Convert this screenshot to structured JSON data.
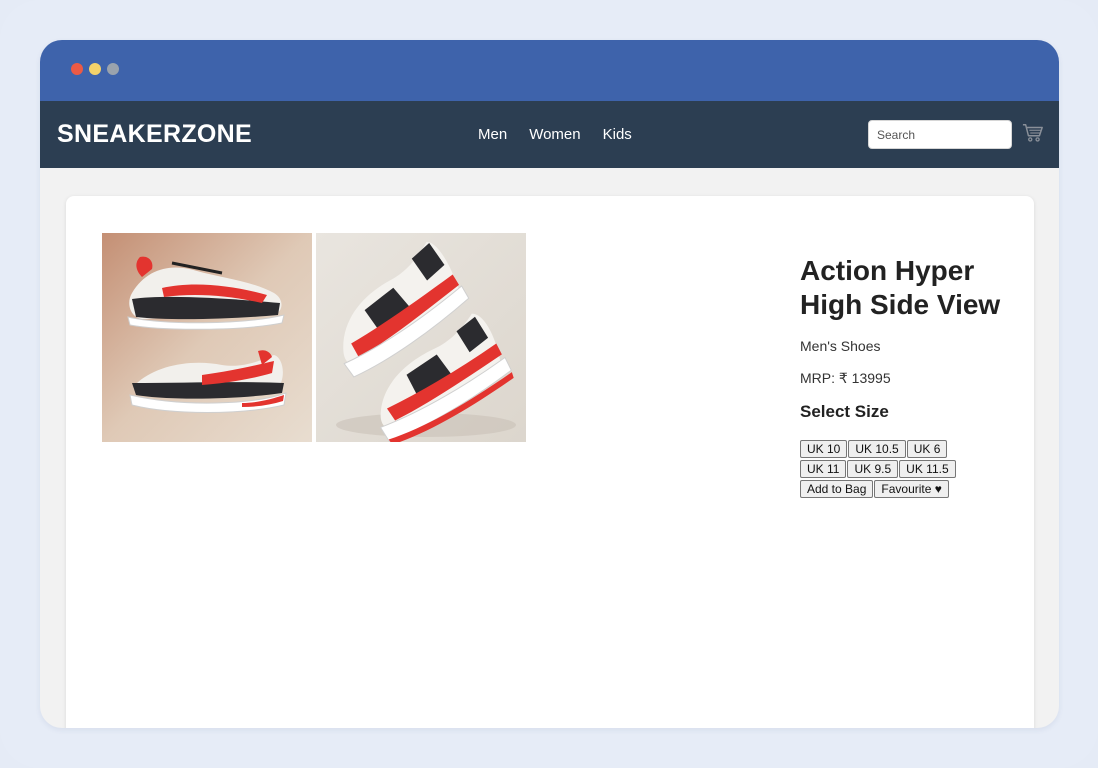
{
  "brand": {
    "name": "SNEAKERZONE"
  },
  "nav": {
    "links": [
      "Men",
      "Women",
      "Kids"
    ]
  },
  "search": {
    "placeholder": "Search"
  },
  "icons": {
    "cart": "cart-icon"
  },
  "colors": {
    "titlebar": "#3e63ab",
    "navbar": "#2c3e52",
    "accent_red": "#e3342f"
  },
  "product": {
    "title": "Action Hyper High Side View",
    "category": "Men's Shoes",
    "price": "MRP: ₹ 13995",
    "select_size_label": "Select Size",
    "sizes": [
      "UK 10",
      "UK 10.5",
      "UK 6",
      "UK 11",
      "UK 9.5",
      "UK 11.5"
    ],
    "add_to_bag": "Add to Bag",
    "favourite": "Favourite ♥"
  }
}
